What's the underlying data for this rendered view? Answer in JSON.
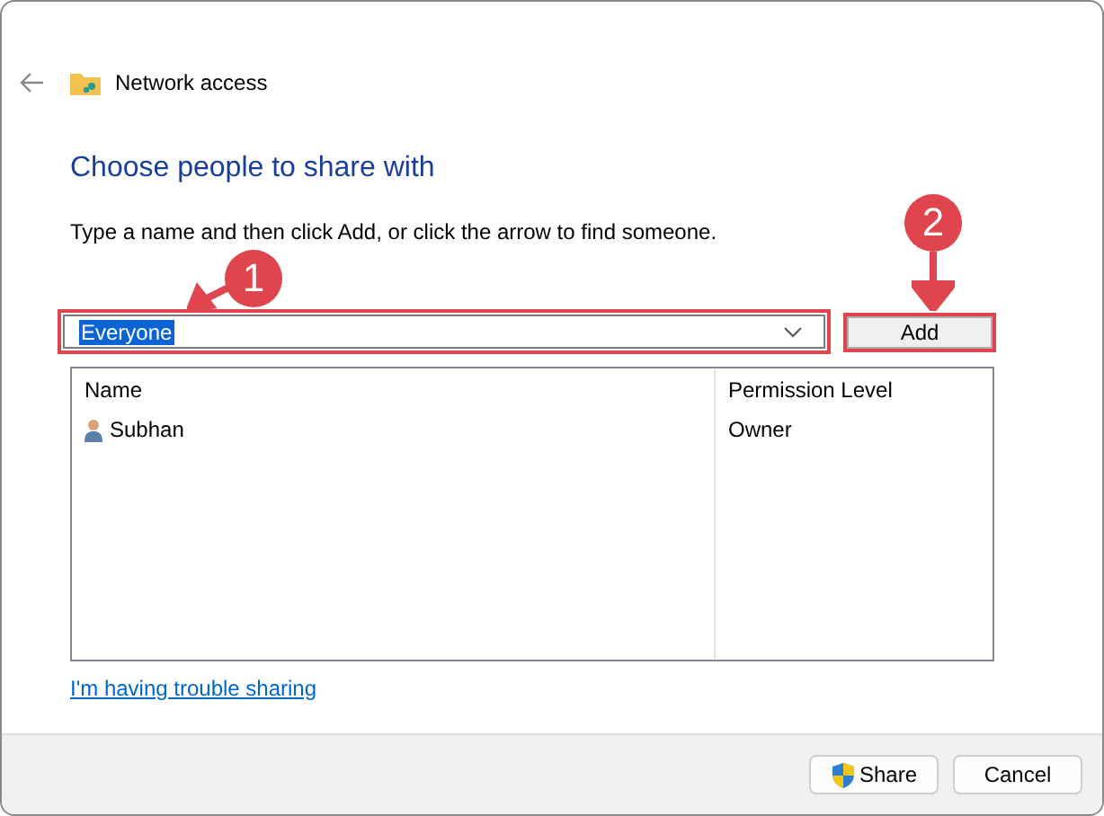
{
  "window": {
    "title": "Network access"
  },
  "heading": "Choose people to share with",
  "instruction": "Type a name and then click Add, or click the arrow to find someone.",
  "name_field": {
    "value": "Everyone",
    "text_selected": true
  },
  "add_button": "Add",
  "table": {
    "columns": [
      "Name",
      "Permission Level"
    ],
    "rows": [
      {
        "name": "Subhan",
        "permission": "Owner"
      }
    ]
  },
  "help_link": "I'm having trouble sharing",
  "buttons": [
    {
      "label": "Share",
      "kind": "shield"
    },
    {
      "label": "Cancel",
      "kind": "plain"
    }
  ],
  "callouts": [
    {
      "number": "1"
    },
    {
      "number": "2"
    }
  ]
}
